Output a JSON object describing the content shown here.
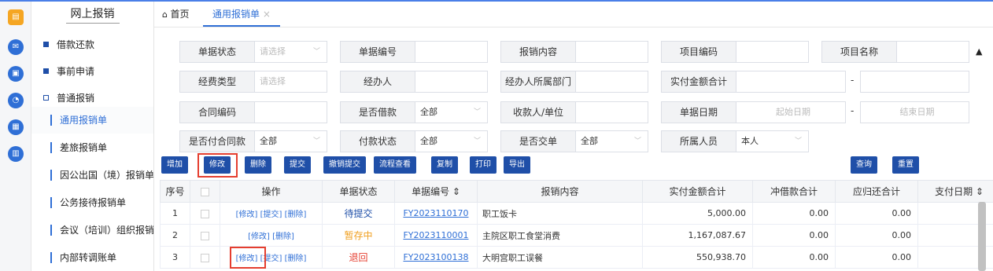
{
  "sidebar": {
    "title": "网上报销",
    "items": [
      {
        "label": "借款还款"
      },
      {
        "label": "事前申请"
      },
      {
        "label": "普通报销"
      },
      {
        "label": "通用报销单"
      },
      {
        "label": "差旅报销单"
      },
      {
        "label": "因公出国（境）报销单"
      },
      {
        "label": "公务接待报销单"
      },
      {
        "label": "会议（培训）组织报销单"
      },
      {
        "label": "内部转调账单"
      }
    ]
  },
  "tabs": {
    "home": "首页",
    "current": "通用报销单",
    "close": "×"
  },
  "filters": {
    "status_label": "单据状态",
    "status_ph": "请选择",
    "no_label": "单据编号",
    "content_label": "报销内容",
    "proj_code_label": "项目编码",
    "proj_name_label": "项目名称",
    "fund_label": "经费类型",
    "fund_ph": "请选择",
    "handler_label": "经办人",
    "dept_label": "经办人所属部门",
    "paid_total_label": "实付金额合计",
    "contract_label": "合同编码",
    "borrow_label": "是否借款",
    "borrow_val": "全部",
    "payee_label": "收款人/单位",
    "date_label": "单据日期",
    "date_start": "起始日期",
    "date_end": "结束日期",
    "contract_pay_label": "是否付合同款",
    "contract_pay_val": "全部",
    "pay_status_label": "付款状态",
    "pay_status_val": "全部",
    "submitted_label": "是否交单",
    "submitted_val": "全部",
    "owner_label": "所属人员",
    "owner_val": "本人",
    "dash": "-",
    "collapse": "▲",
    "caret": "﹀"
  },
  "toolbar": {
    "add": "增加",
    "edit": "修改",
    "delete": "删除",
    "submit": "提交",
    "withdraw": "撤销提交",
    "flow": "流程查看",
    "copy": "复制",
    "print": "打印",
    "export": "导出",
    "query": "查询",
    "reset": "重置"
  },
  "table": {
    "headers": [
      "序号",
      "",
      "操作",
      "单据状态",
      "单据编号 ⇕",
      "报销内容",
      "实付金额合计",
      "冲借款合计",
      "应归还合计",
      "支付日期 ⇕",
      ""
    ],
    "rows": [
      {
        "idx": "1",
        "actions": "[修改] [提交] [删除]",
        "status": "待提交",
        "status_color": "#1f4fa8",
        "no": "FY2023110170",
        "content": "职工饭卡",
        "paid": "5,000.00",
        "offset": "0.00",
        "return": "0.00",
        "paydate": ""
      },
      {
        "idx": "2",
        "actions": "[修改] [删除]",
        "status": "暂存中",
        "status_color": "#f0a020",
        "no": "FY2023110001",
        "content": "主院区职工食堂消费",
        "paid": "1,167,087.67",
        "offset": "0.00",
        "return": "0.00",
        "paydate": ""
      },
      {
        "idx": "3",
        "actions": "[修改] [提交] [删除]",
        "status": "退回",
        "status_color": "#e53e2f",
        "no": "FY2023100138",
        "content": "大明宫职工误餐",
        "paid": "550,938.70",
        "offset": "0.00",
        "return": "0.00",
        "paydate": ""
      }
    ]
  }
}
